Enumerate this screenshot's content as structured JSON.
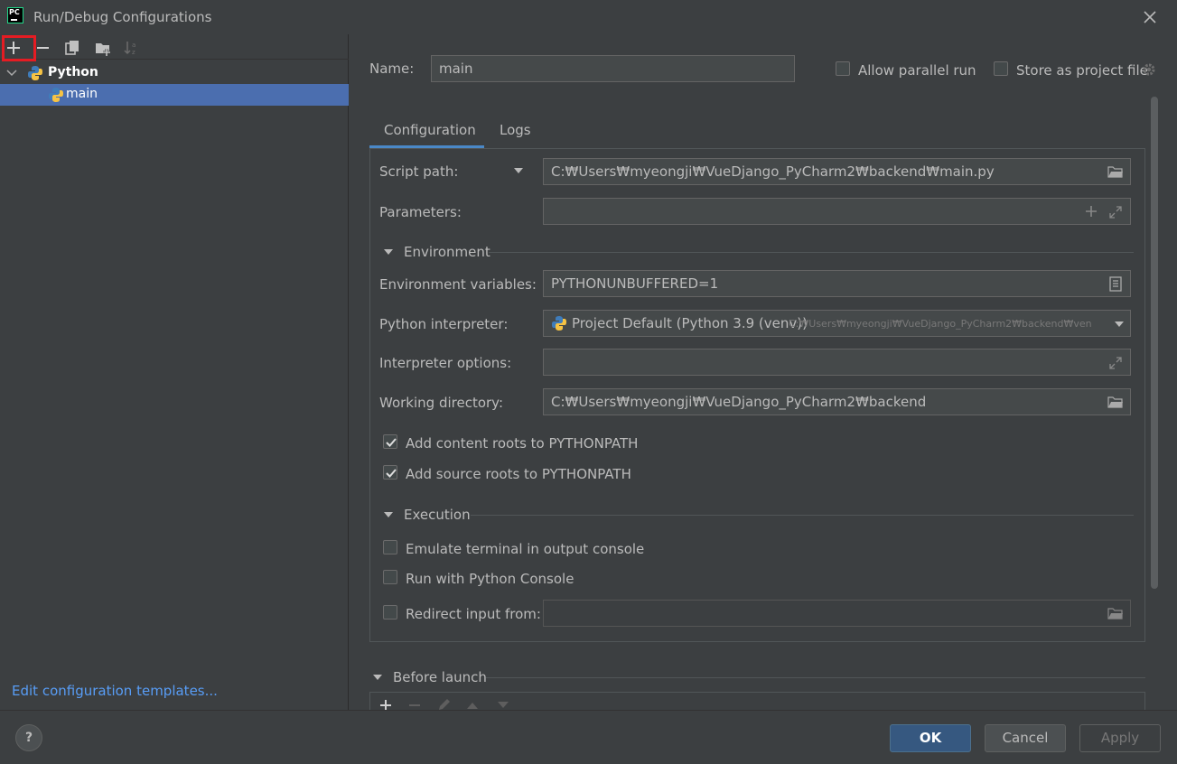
{
  "window": {
    "title": "Run/Debug Configurations"
  },
  "colors": {
    "accent": "#4b6eaf",
    "link": "#589df6",
    "highlight": "#e51c23",
    "tab_underline": "#4a88c7"
  },
  "tree": {
    "group_label": "Python",
    "item_label": "main"
  },
  "left": {
    "edit_templates": "Edit configuration templates..."
  },
  "form": {
    "name_label": "Name:",
    "name_value": "main",
    "allow_parallel": "Allow parallel run",
    "store_project": "Store as project file",
    "tabs": [
      "Configuration",
      "Logs"
    ],
    "script_path_label": "Script path:",
    "script_path_value": "C:₩Users₩myeongji₩VueDjango_PyCharm2₩backend₩main.py",
    "parameters_label": "Parameters:",
    "environment_section": "Environment",
    "env_vars_label": "Environment variables:",
    "env_vars_value": "PYTHONUNBUFFERED=1",
    "interpreter_label": "Python interpreter:",
    "interpreter_value": "Project Default (Python 3.9 (venv))",
    "interpreter_path": "C:₩Users₩myeongji₩VueDjango_PyCharm2₩backend₩ven",
    "interp_options_label": "Interpreter options:",
    "workdir_label": "Working directory:",
    "workdir_value": "C:₩Users₩myeongji₩VueDjango_PyCharm2₩backend",
    "content_roots": "Add content roots to PYTHONPATH",
    "source_roots": "Add source roots to PYTHONPATH",
    "execution_section": "Execution",
    "emulate_terminal": "Emulate terminal in output console",
    "python_console": "Run with Python Console",
    "redirect_input": "Redirect input from:",
    "before_launch": "Before launch"
  },
  "buttons": {
    "help": "?",
    "ok": "OK",
    "cancel": "Cancel",
    "apply": "Apply"
  }
}
